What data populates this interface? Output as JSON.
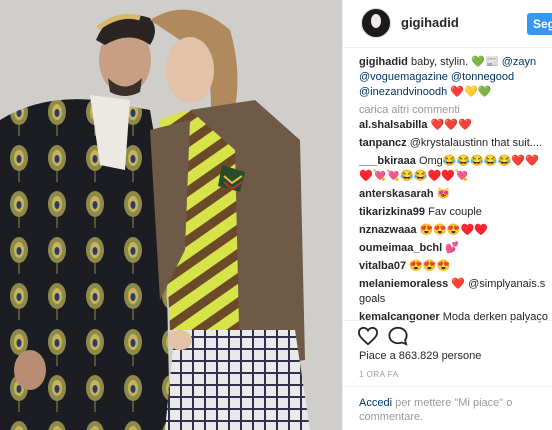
{
  "header": {
    "username": "gigihadid",
    "follow_label": "Segui"
  },
  "caption": {
    "username": "gigihadid",
    "text_before": "baby, stylin. ",
    "emoji_1": "💚📰",
    "mention_1": "@zayn",
    "mention_2": "@voguemagazine",
    "mention_3": "@tonnegood",
    "mention_4": "@inezandvinoodh",
    "emoji_2": "❤️💛💚"
  },
  "load_more": "carica altri commenti",
  "comments": [
    {
      "user": "al.shalsabilla",
      "text": "❤️❤️❤️"
    },
    {
      "user": "tanpancz",
      "text": "@krystalaustinn that suit...."
    },
    {
      "user": "___bkiraaa",
      "text": "Omg😂😂😂😂😂❤️❤️♥️💘💘😂😂♥️♥️💘"
    },
    {
      "user": "anterskasarah",
      "text": "😻"
    },
    {
      "user": "tikarizkina99",
      "text": "Fav couple"
    },
    {
      "user": "nznazwaaa",
      "text": "😍😍😍♥️♥️"
    },
    {
      "user": "oumeimaa_bchl",
      "text": "💕"
    },
    {
      "user": "vitalba07",
      "text": "😍😍😍"
    },
    {
      "user": "melaniemoraless",
      "text": "❤️ @simplyanais.s goals"
    },
    {
      "user": "kemalcangoner",
      "text": "Moda derken palyaço"
    }
  ],
  "likes": "Piace a 863.829 persone",
  "timestamp": "1 ORA FA",
  "login": {
    "link": "Accedi",
    "text": " per mettere \"Mi piace\" o commentare."
  },
  "icons": {
    "like": "heart-icon",
    "comment": "comment-icon"
  }
}
